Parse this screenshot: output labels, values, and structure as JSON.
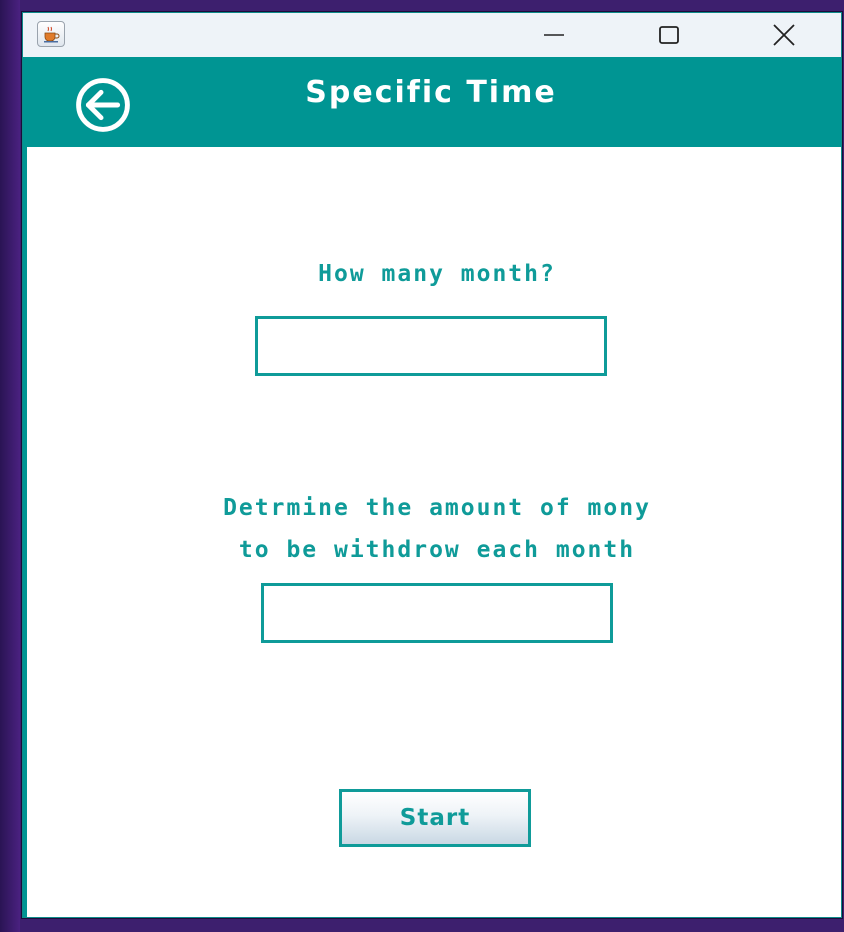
{
  "window": {
    "icon": "java-cup-icon",
    "controls": {
      "minimize": "minimize-icon",
      "maximize": "maximize-icon",
      "close": "close-icon"
    }
  },
  "header": {
    "title": "Specific Time",
    "back_icon": "back-arrow-icon",
    "background": "#009593"
  },
  "form": {
    "months_label": "How many month?",
    "months_value": "",
    "amount_label_line1": "Detrmine the amount of mony",
    "amount_label_line2": "to be withdrow each month",
    "amount_value": "",
    "start_label": "Start"
  },
  "colors": {
    "accent": "#0f9b99",
    "header": "#009593",
    "title_text": "#ffffff"
  }
}
